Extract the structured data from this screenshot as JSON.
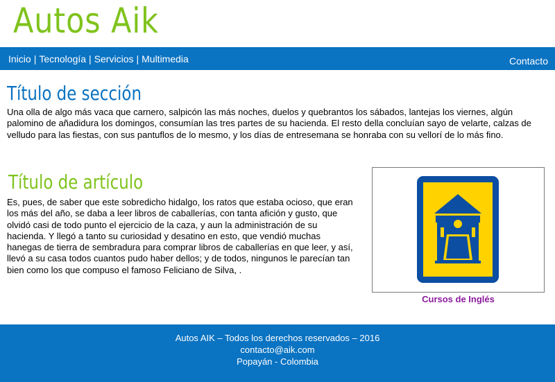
{
  "header": {
    "logo": "Autos Aik"
  },
  "nav": {
    "items": [
      {
        "label": "Inicio"
      },
      {
        "label": "Tecnología"
      },
      {
        "label": "Servicios"
      },
      {
        "label": "Multimedia"
      }
    ],
    "separator": "|",
    "contact": "Contacto"
  },
  "section": {
    "title": "Título de sección",
    "text": "Una olla de algo más vaca que carnero, salpicón las más noches, duelos y quebrantos los sábados, lantejas los viernes, algún palomino de añadidura los domingos, consumían las tres partes de su hacienda. El resto della concluían sayo de velarte, calzas de velludo para las fiestas, con sus pantuflos de lo mesmo, y los días de entresemana se honraba con su vellorí de lo más fino."
  },
  "article": {
    "title": "Título de artículo",
    "text": "Es, pues, de saber que este sobredicho hidalgo, los ratos que estaba ocioso, que eran los más del año, se daba a leer libros de caballerías, con tanta afición y gusto, que olvidó casi de todo punto el ejercicio de la caza, y aun la administración de su hacienda. Y llegó a tanto su curiosidad y desatino en esto, que vendió muchas hanegas de tierra de sembradura para comprar libros de caballerías en que leer, y así, llevó a su casa todos cuantos pudo haber dellos; y de todos, ningunos le parecían tan bien como los que compuso el famoso Feliciano de Silva, ."
  },
  "figure": {
    "icon": "school-sign-icon",
    "caption": "Cursos de Inglés",
    "colors": {
      "frame": "#0b4ea2",
      "background": "#ffd200"
    }
  },
  "footer": {
    "line1": "Autos AIK – Todos los derechos reservados – 2016",
    "line2": "contacto@aik.com",
    "line3": "Popayán - Colombia"
  },
  "colors": {
    "brand_green": "#7fc31c",
    "brand_blue": "#0a73c2",
    "link_purple": "#8b1a9c"
  }
}
